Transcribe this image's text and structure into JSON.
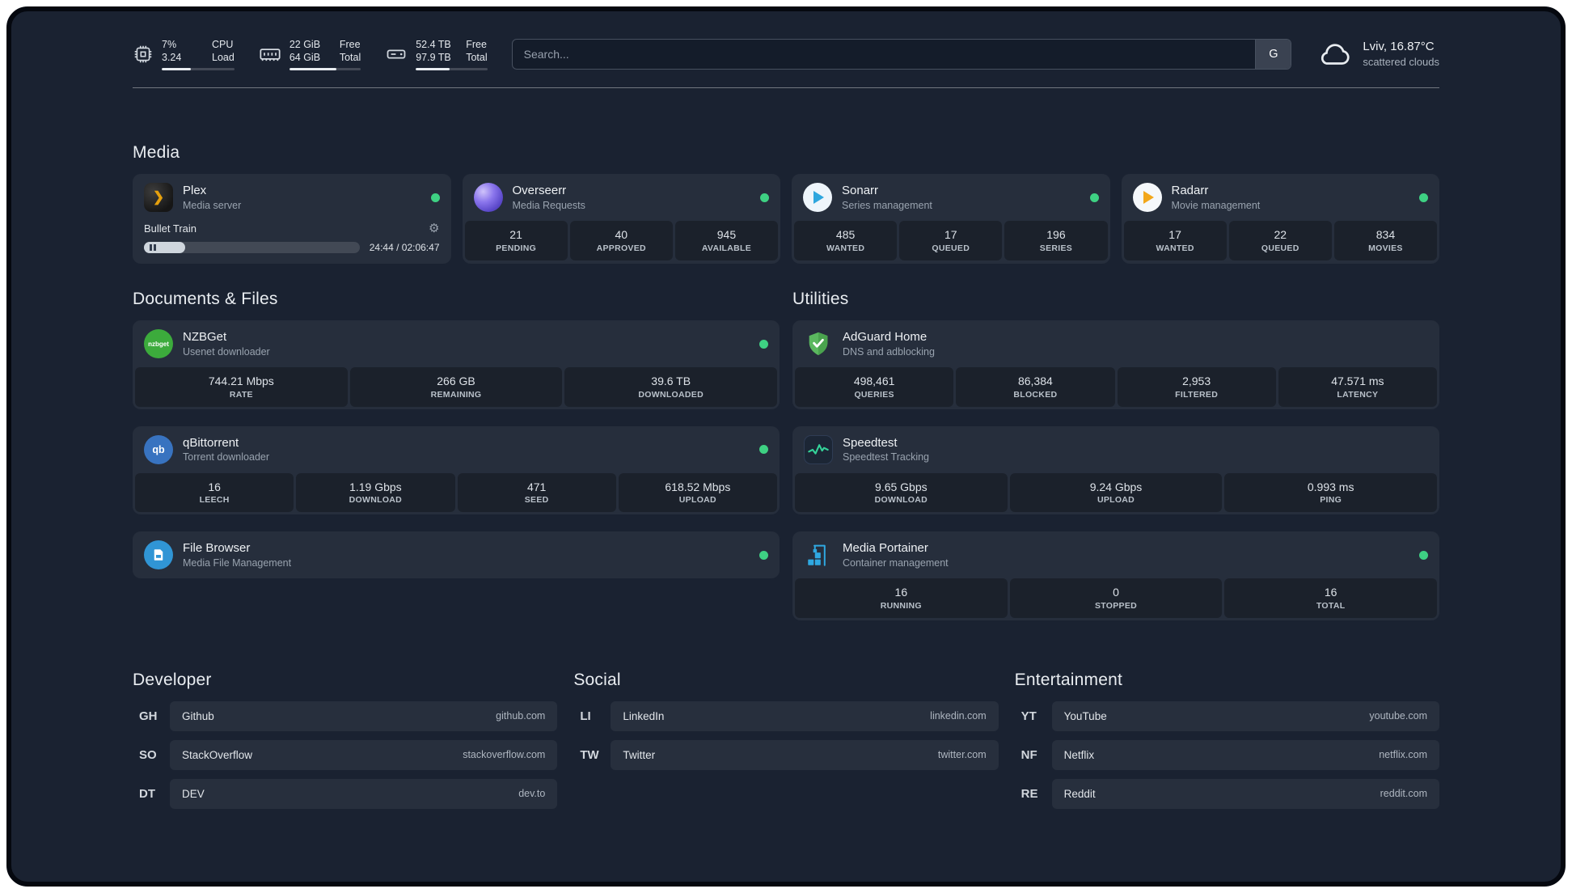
{
  "theme": {
    "panel_bg": "#1a2231",
    "card_bg": "rgba(255,255,255,0.055)",
    "stat_bg": "rgba(0,0,0,0.28)",
    "status_green": "#3ed183",
    "plex_gold": "#e5a00d"
  },
  "topbar": {
    "cpu": {
      "value1": "7%",
      "value2": "3.24",
      "label1": "CPU",
      "label2": "Load",
      "progress": "40%"
    },
    "memory": {
      "value1": "22 GiB",
      "value2": "64 GiB",
      "label1": "Free",
      "label2": "Total",
      "progress": "66%"
    },
    "disk": {
      "value1": "52.4 TB",
      "value2": "97.9 TB",
      "label1": "Free",
      "label2": "Total",
      "progress": "47%"
    },
    "search": {
      "placeholder": "Search...",
      "provider_label": "G"
    },
    "weather": {
      "location": "Lviv, 16.87°C",
      "condition": "scattered clouds"
    }
  },
  "media": {
    "heading": "Media",
    "plex": {
      "name": "Plex",
      "subtitle": "Media server",
      "now_playing": "Bullet Train",
      "time": "24:44 / 02:06:47",
      "progress": "19%"
    },
    "overseerr": {
      "name": "Overseerr",
      "subtitle": "Media Requests",
      "stats": [
        {
          "value": "21",
          "label": "PENDING"
        },
        {
          "value": "40",
          "label": "APPROVED"
        },
        {
          "value": "945",
          "label": "AVAILABLE"
        }
      ]
    },
    "sonarr": {
      "name": "Sonarr",
      "subtitle": "Series management",
      "stats": [
        {
          "value": "485",
          "label": "WANTED"
        },
        {
          "value": "17",
          "label": "QUEUED"
        },
        {
          "value": "196",
          "label": "SERIES"
        }
      ]
    },
    "radarr": {
      "name": "Radarr",
      "subtitle": "Movie management",
      "stats": [
        {
          "value": "17",
          "label": "WANTED"
        },
        {
          "value": "22",
          "label": "QUEUED"
        },
        {
          "value": "834",
          "label": "MOVIES"
        }
      ]
    }
  },
  "documents": {
    "heading": "Documents & Files",
    "nzbget": {
      "name": "NZBGet",
      "subtitle": "Usenet downloader",
      "stats": [
        {
          "value": "744.21 Mbps",
          "label": "RATE"
        },
        {
          "value": "266 GB",
          "label": "REMAINING"
        },
        {
          "value": "39.6 TB",
          "label": "DOWNLOADED"
        }
      ]
    },
    "qbittorrent": {
      "name": "qBittorrent",
      "subtitle": "Torrent downloader",
      "stats": [
        {
          "value": "16",
          "label": "LEECH"
        },
        {
          "value": "1.19 Gbps",
          "label": "DOWNLOAD"
        },
        {
          "value": "471",
          "label": "SEED"
        },
        {
          "value": "618.52 Mbps",
          "label": "UPLOAD"
        }
      ]
    },
    "filebrowser": {
      "name": "File Browser",
      "subtitle": "Media File Management"
    }
  },
  "utilities": {
    "heading": "Utilities",
    "adguard": {
      "name": "AdGuard Home",
      "subtitle": "DNS and adblocking",
      "stats": [
        {
          "value": "498,461",
          "label": "QUERIES"
        },
        {
          "value": "86,384",
          "label": "BLOCKED"
        },
        {
          "value": "2,953",
          "label": "FILTERED"
        },
        {
          "value": "47.571 ms",
          "label": "LATENCY"
        }
      ]
    },
    "speedtest": {
      "name": "Speedtest",
      "subtitle": "Speedtest Tracking",
      "stats": [
        {
          "value": "9.65 Gbps",
          "label": "DOWNLOAD"
        },
        {
          "value": "9.24 Gbps",
          "label": "UPLOAD"
        },
        {
          "value": "0.993 ms",
          "label": "PING"
        }
      ]
    },
    "portainer": {
      "name": "Media Portainer",
      "subtitle": "Container management",
      "stats": [
        {
          "value": "16",
          "label": "RUNNING"
        },
        {
          "value": "0",
          "label": "STOPPED"
        },
        {
          "value": "16",
          "label": "TOTAL"
        }
      ]
    }
  },
  "bookmarks": {
    "developer": {
      "heading": "Developer",
      "items": [
        {
          "abbr": "GH",
          "name": "Github",
          "domain": "github.com"
        },
        {
          "abbr": "SO",
          "name": "StackOverflow",
          "domain": "stackoverflow.com"
        },
        {
          "abbr": "DT",
          "name": "DEV",
          "domain": "dev.to"
        }
      ]
    },
    "social": {
      "heading": "Social",
      "items": [
        {
          "abbr": "LI",
          "name": "LinkedIn",
          "domain": "linkedin.com"
        },
        {
          "abbr": "TW",
          "name": "Twitter",
          "domain": "twitter.com"
        }
      ]
    },
    "entertainment": {
      "heading": "Entertainment",
      "items": [
        {
          "abbr": "YT",
          "name": "YouTube",
          "domain": "youtube.com"
        },
        {
          "abbr": "NF",
          "name": "Netflix",
          "domain": "netflix.com"
        },
        {
          "abbr": "RE",
          "name": "Reddit",
          "domain": "reddit.com"
        }
      ]
    }
  },
  "icons": {
    "plex_glyph": "❯",
    "qb_glyph": "qb",
    "nzbget_glyph": "nzbget",
    "gear_glyph": "⚙"
  }
}
